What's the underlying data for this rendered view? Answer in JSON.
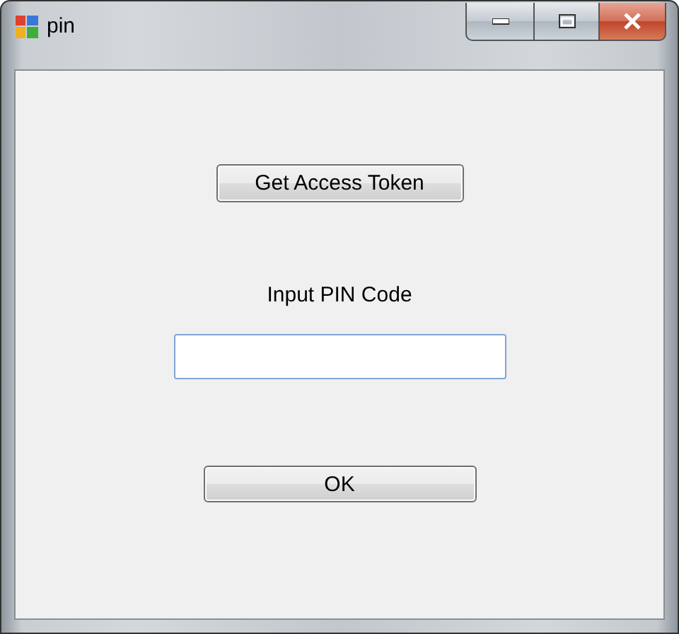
{
  "window": {
    "title": "pin"
  },
  "token_button": {
    "label": "Get Access Token"
  },
  "pin_label": "Input PIN Code",
  "pin_field": {
    "focused": true
  },
  "ok_button": {
    "label": "OK"
  }
}
